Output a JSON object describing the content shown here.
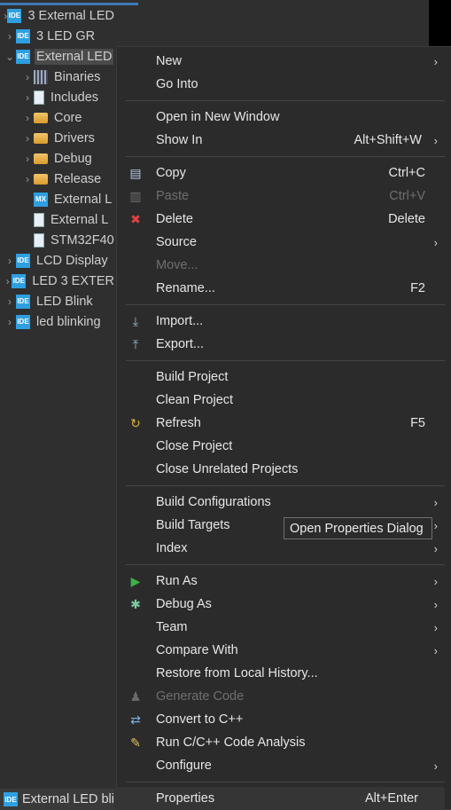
{
  "tree": [
    {
      "label": "3 External LED",
      "icon": "ide",
      "expander": "collapsed",
      "indent": 0
    },
    {
      "label": "3 LED GR",
      "icon": "ide",
      "expander": "collapsed",
      "indent": 0
    },
    {
      "label": "External LED",
      "icon": "ide",
      "expander": "expanded",
      "indent": 0,
      "selected": true
    },
    {
      "label": "Binaries",
      "icon": "binaries",
      "expander": "collapsed",
      "indent": 1
    },
    {
      "label": "Includes",
      "icon": "includes",
      "expander": "collapsed",
      "indent": 1
    },
    {
      "label": "Core",
      "icon": "source-folder",
      "expander": "collapsed",
      "indent": 1
    },
    {
      "label": "Drivers",
      "icon": "source-folder",
      "expander": "collapsed",
      "indent": 1
    },
    {
      "label": "Debug",
      "icon": "folder",
      "expander": "collapsed",
      "indent": 1
    },
    {
      "label": "Release",
      "icon": "folder",
      "expander": "collapsed",
      "indent": 1
    },
    {
      "label": "External L",
      "icon": "mx",
      "expander": "none",
      "indent": 1
    },
    {
      "label": "External L",
      "icon": "file",
      "expander": "none",
      "indent": 1
    },
    {
      "label": "STM32F40",
      "icon": "linker-file",
      "expander": "none",
      "indent": 1
    },
    {
      "label": "LCD Display",
      "icon": "ide",
      "expander": "collapsed",
      "indent": 0
    },
    {
      "label": " LED 3 EXTER",
      "icon": "ide-warning",
      "expander": "collapsed",
      "indent": 0
    },
    {
      "label": "LED Blink",
      "icon": "ide-warning",
      "expander": "collapsed",
      "indent": 0
    },
    {
      "label": "led blinking",
      "icon": "ide",
      "expander": "collapsed",
      "indent": 0
    }
  ],
  "status_bar": {
    "label": "External LED bli",
    "icon": "ide"
  },
  "menu": [
    {
      "label": "New",
      "submenu": true
    },
    {
      "label": "Go Into"
    },
    {
      "sep": true
    },
    {
      "label": "Open in New Window"
    },
    {
      "label": "Show In",
      "shortcut": "Alt+Shift+W",
      "submenu": true
    },
    {
      "sep": true
    },
    {
      "label": "Copy",
      "shortcut": "Ctrl+C",
      "icon": "copy"
    },
    {
      "label": "Paste",
      "shortcut": "Ctrl+V",
      "icon": "paste",
      "disabled": true
    },
    {
      "label": "Delete",
      "shortcut": "Delete",
      "icon": "delete"
    },
    {
      "label": "Source",
      "submenu": true
    },
    {
      "label": "Move...",
      "disabled": true
    },
    {
      "label": "Rename...",
      "shortcut": "F2"
    },
    {
      "sep": true
    },
    {
      "label": "Import...",
      "icon": "import"
    },
    {
      "label": "Export...",
      "icon": "export"
    },
    {
      "sep": true
    },
    {
      "label": "Build Project"
    },
    {
      "label": "Clean Project"
    },
    {
      "label": "Refresh",
      "shortcut": "F5",
      "icon": "refresh"
    },
    {
      "label": "Close Project"
    },
    {
      "label": "Close Unrelated Projects"
    },
    {
      "sep": true
    },
    {
      "label": "Build Configurations",
      "submenu": true
    },
    {
      "label": "Build Targets",
      "submenu": true
    },
    {
      "label": "Index",
      "submenu": true
    },
    {
      "sep": true
    },
    {
      "label": "Run As",
      "submenu": true,
      "icon": "run"
    },
    {
      "label": "Debug As",
      "submenu": true,
      "icon": "debug"
    },
    {
      "label": "Team",
      "submenu": true
    },
    {
      "label": "Compare With",
      "submenu": true
    },
    {
      "label": "Restore from Local History..."
    },
    {
      "label": "Generate Code",
      "icon": "generate-code",
      "disabled": true
    },
    {
      "label": "Convert to C++",
      "icon": "convert"
    },
    {
      "label": "Run C/C++ Code Analysis",
      "icon": "code-analysis"
    },
    {
      "label": "Configure",
      "submenu": true
    },
    {
      "sep": true
    },
    {
      "label": "Properties",
      "shortcut": "Alt+Enter",
      "highlighted": true
    }
  ],
  "tooltip": "Open Properties Dialog",
  "colors": {
    "menu_bg": "#2b2b2b",
    "tree_bg": "#2f2f2f",
    "selection": "#4a4a4a",
    "ide_icon": "#2e9fe0",
    "disabled_text": "#6f6f6f"
  }
}
